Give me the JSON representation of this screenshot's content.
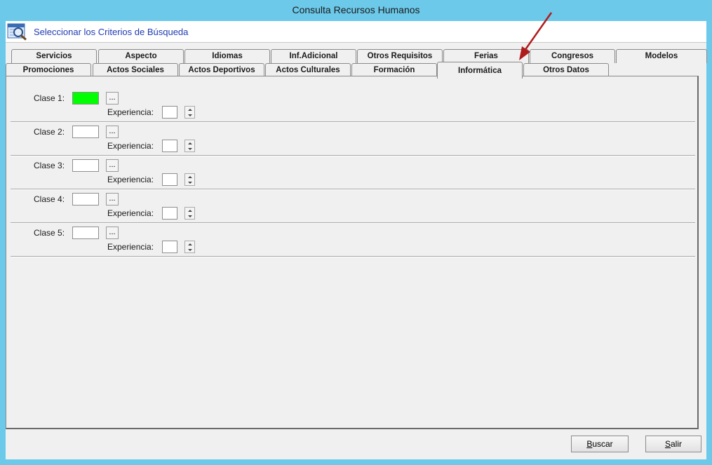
{
  "window": {
    "title": "Consulta Recursos Humanos"
  },
  "header": {
    "title": "Seleccionar los Criterios de Búsqueda",
    "icon": "search-calendar-icon"
  },
  "tabs_row1": [
    "Servicios",
    "Aspecto",
    "Idiomas",
    "Inf.Adicional",
    "Otros Requisitos",
    "Ferias",
    "Congresos",
    "Modelos"
  ],
  "tabs_row2": [
    "Promociones",
    "Actos Sociales",
    "Actos Deportivos",
    "Actos Culturales",
    "Formación",
    "Informática",
    "Otros Datos"
  ],
  "active_tab": "Informática",
  "classes": [
    {
      "label": "Clase 1:",
      "value": "",
      "experience_label": "Experiencia:",
      "experience": ""
    },
    {
      "label": "Clase 2:",
      "value": "",
      "experience_label": "Experiencia:",
      "experience": ""
    },
    {
      "label": "Clase 3:",
      "value": "",
      "experience_label": "Experiencia:",
      "experience": ""
    },
    {
      "label": "Clase 4:",
      "value": "",
      "experience_label": "Experiencia:",
      "experience": ""
    },
    {
      "label": "Clase 5:",
      "value": "",
      "experience_label": "Experiencia:",
      "experience": ""
    }
  ],
  "browse_label": "...",
  "buttons": {
    "search_first": "B",
    "search_rest": "uscar",
    "exit_first": "S",
    "exit_rest": "alir"
  },
  "colors": {
    "active_field": "#00ff00",
    "title_accent": "#1f3bb3",
    "frame": "#6cc9ea",
    "annotation_arrow": "#b01c1c"
  }
}
